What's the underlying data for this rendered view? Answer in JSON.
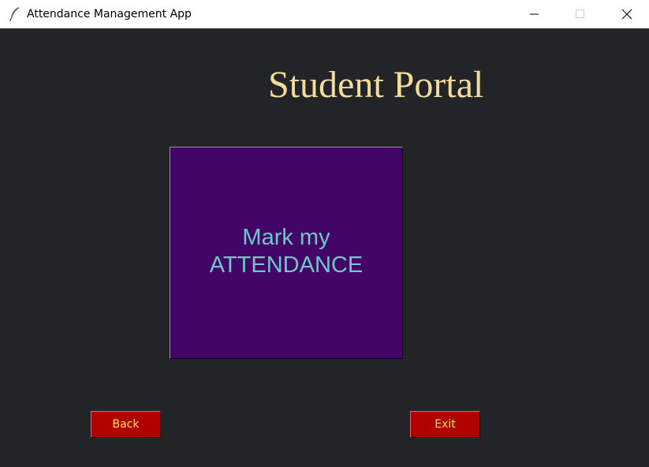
{
  "window": {
    "title": "Attendance Management App",
    "icon": "feather-icon",
    "controls": {
      "minimize_icon": "minimize-icon",
      "maximize_icon": "maximize-icon",
      "close_icon": "close-icon"
    }
  },
  "main": {
    "heading": "Student Portal",
    "attendance_button": {
      "line1": "Mark my",
      "line2": "ATTENDANCE"
    },
    "back_label": "Back",
    "exit_label": "Exit"
  },
  "colors": {
    "background": "#222428",
    "heading": "#f5dc9b",
    "attendance_bg": "#430568",
    "attendance_text": "#6fc8c8",
    "small_button_bg": "#b00000",
    "small_button_text": "#ffe14a"
  }
}
